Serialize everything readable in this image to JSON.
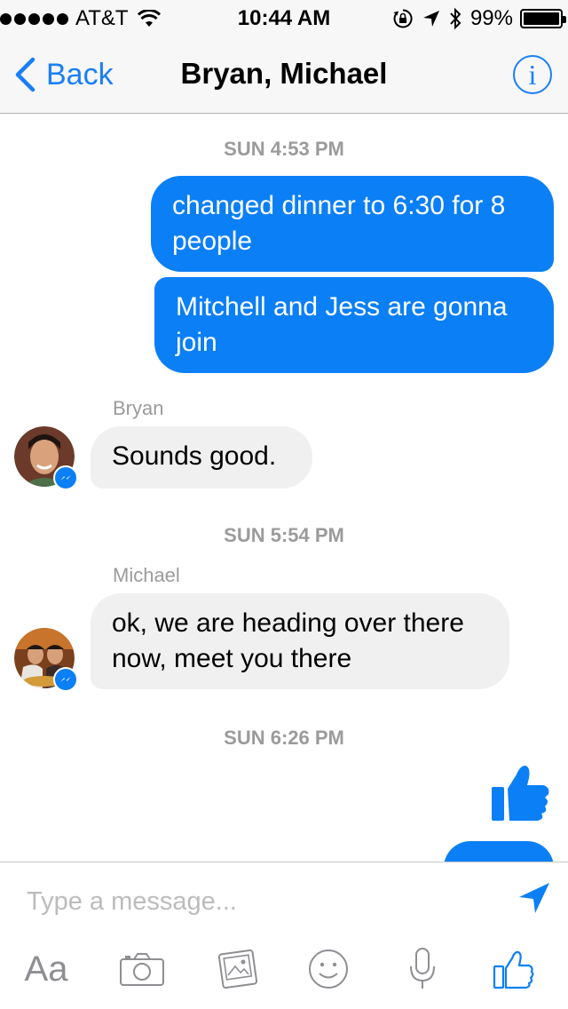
{
  "status_bar": {
    "carrier": "AT&T",
    "time": "10:44 AM",
    "battery_percent": "99%",
    "battery_level": 0.99,
    "icons": [
      "signal-dots-icon",
      "wifi-icon",
      "rotation-lock-icon",
      "location-icon",
      "bluetooth-icon",
      "battery-icon"
    ]
  },
  "nav": {
    "back_label": "Back",
    "title": "Bryan, Michael",
    "info_glyph": "i"
  },
  "thread": {
    "timestamps": [
      "SUN 4:53 PM",
      "SUN 5:54 PM",
      "SUN 6:26 PM"
    ],
    "outgoing_1": "changed dinner to 6:30 for 8 people",
    "outgoing_2": "Mitchell and Jess are gonna join",
    "bryan": {
      "sender": "Bryan",
      "text": "Sounds good."
    },
    "michael": {
      "sender": "Michael",
      "text": "ok, we are heading over there now, meet you there"
    },
    "last_outgoing": "thumbs-up-sticker"
  },
  "composer": {
    "placeholder": "Type a message...",
    "value": "",
    "aa_label": "Aa",
    "tools": [
      "text-format",
      "camera-icon",
      "photo-icon",
      "emoji-icon",
      "microphone-icon",
      "like-icon"
    ]
  },
  "colors": {
    "accent": "#0b7ff5",
    "incoming_bubble": "#f0f0f0",
    "meta_text": "#9b9b9b"
  }
}
